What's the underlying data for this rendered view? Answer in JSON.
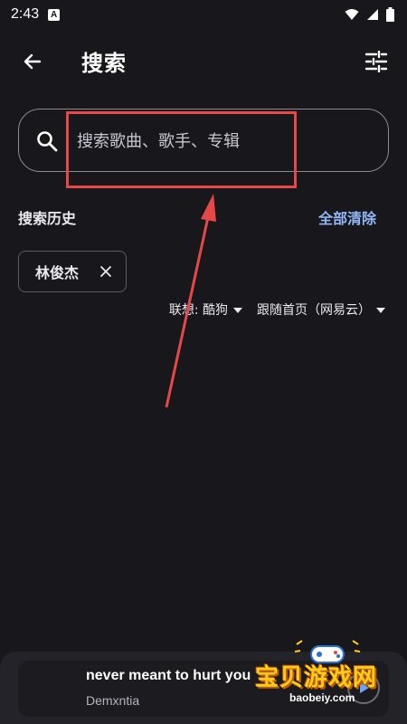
{
  "status_bar": {
    "time": "2:43",
    "app_icon_letter": "A",
    "icons": [
      "wifi-icon",
      "signal-icon",
      "battery-icon"
    ]
  },
  "header": {
    "title": "搜索",
    "back_icon": "arrow-left-icon",
    "settings_icon": "tune-icon"
  },
  "search": {
    "placeholder": "搜索歌曲、歌手、专辑",
    "value": ""
  },
  "history": {
    "title": "搜索历史",
    "clear_label": "全部清除",
    "items": [
      {
        "label": "林俊杰"
      }
    ]
  },
  "options": {
    "suggest_label": "联想: 酷狗",
    "follow_label": "跟随首页（网易云）"
  },
  "player": {
    "title": "never meant to hurt you",
    "artist": "Demxntia"
  },
  "watermark": {
    "text": "宝贝游戏网",
    "url": "baobeiy.com"
  },
  "colors": {
    "background": "#17171c",
    "accent": "#93b6f7",
    "annotation": "#e64848"
  }
}
